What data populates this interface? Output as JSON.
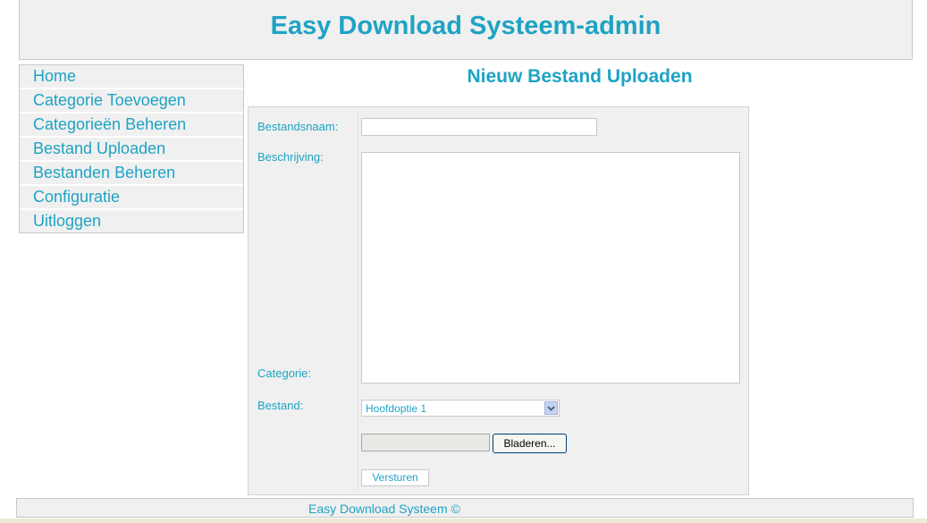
{
  "header": {
    "title": "Easy Download Systeem-admin"
  },
  "sidebar": {
    "items": [
      {
        "label": "Home"
      },
      {
        "label": "Categorie Toevoegen"
      },
      {
        "label": "Categorieën Beheren"
      },
      {
        "label": "Bestand Uploaden"
      },
      {
        "label": "Bestanden Beheren"
      },
      {
        "label": "Configuratie"
      },
      {
        "label": "Uitloggen"
      }
    ]
  },
  "main": {
    "title": "Nieuw Bestand Uploaden",
    "form": {
      "filename_label": "Bestandsnaam:",
      "filename_value": "",
      "description_label": "Beschrijving:",
      "description_value": "",
      "category_label": "Categorie:",
      "category_selected": "Hoofdoptie 1",
      "file_label": "Bestand:",
      "browse_label": "Bladeren...",
      "submit_label": "Versturen"
    }
  },
  "footer": {
    "text": "Easy Download Systeem ©"
  },
  "colors": {
    "accent": "#1ea3c4",
    "panel": "#f0f0f0",
    "border": "#c8c8c8"
  }
}
